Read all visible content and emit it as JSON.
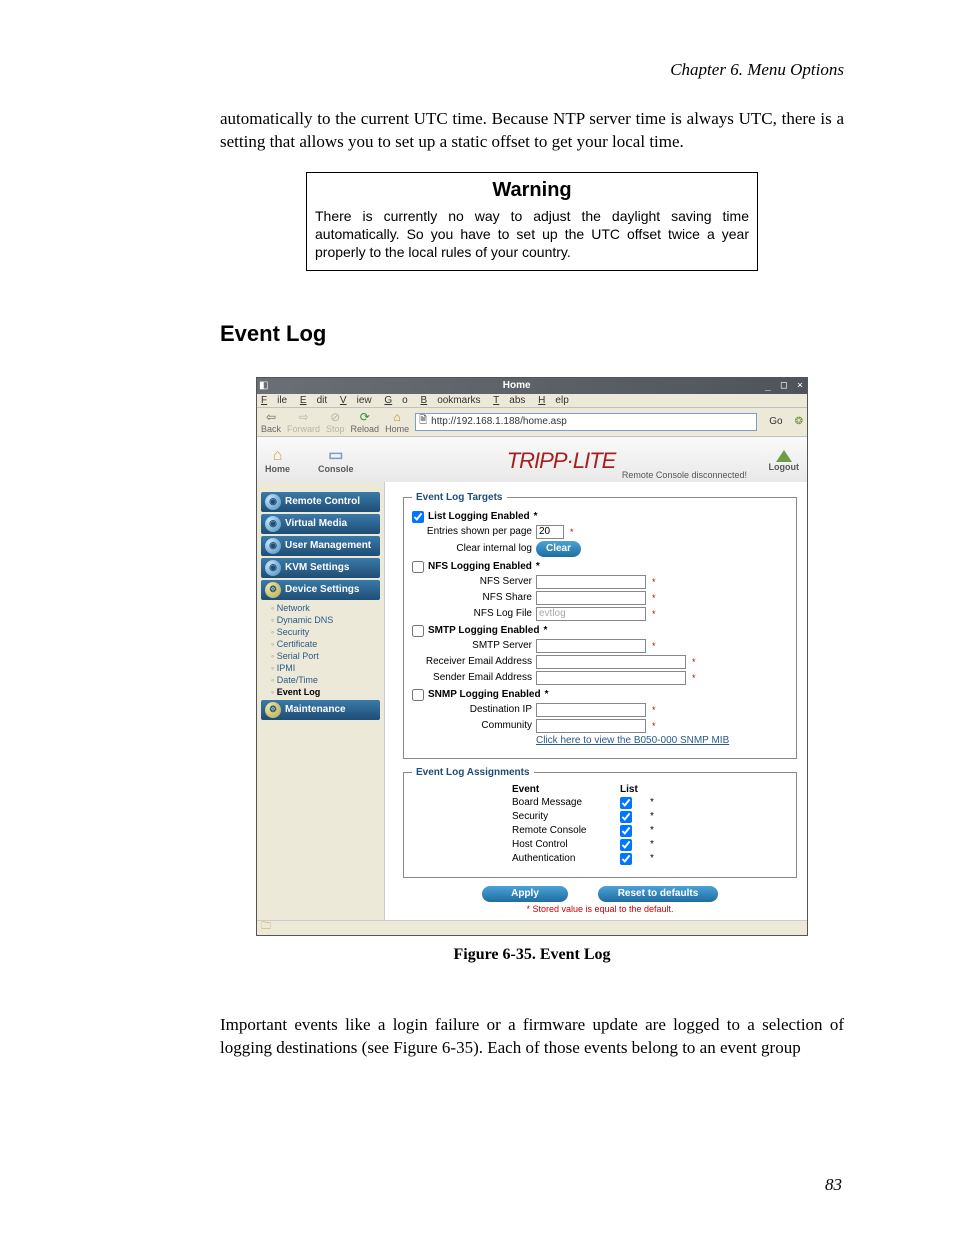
{
  "page": {
    "chapter_header": "Chapter 6. Menu Options",
    "intro_para": "automatically to the current UTC time. Because NTP server time is always UTC, there is a setting that allows you to set up a static offset to get your local time.",
    "warning_title": "Warning",
    "warning_body": "There is currently no way to adjust the daylight saving time automatically. So you have to set up the UTC offset twice a year properly to the local rules of your country.",
    "section_title": "Event Log",
    "figure_caption": "Figure 6-35. Event Log",
    "outro_para": "Important events like a login failure or a firmware update are logged to a selection of logging destinations (see Figure 6-35). Each of those events belong to an event group",
    "page_number": "83"
  },
  "browser": {
    "window_title": "Home",
    "window_controls": "_ □ ×",
    "menus": [
      "File",
      "Edit",
      "View",
      "Go",
      "Bookmarks",
      "Tabs",
      "Help"
    ],
    "toolbar": {
      "back": "Back",
      "forward": "Forward",
      "stop": "Stop",
      "reload": "Reload",
      "home": "Home",
      "go": "Go"
    },
    "url": "http://192.168.1.188/home.asp"
  },
  "appbar": {
    "home": "Home",
    "console": "Console",
    "logo_text": "TRIPP·LITE",
    "status": "Remote Console disconnected!",
    "logout": "Logout"
  },
  "sidebar": {
    "sections": [
      "Remote Control",
      "Virtual Media",
      "User Management",
      "KVM Settings",
      "Device Settings",
      "Maintenance"
    ],
    "device_links": [
      "Network",
      "Dynamic DNS",
      "Security",
      "Certificate",
      "Serial Port",
      "IPMI",
      "Date/Time",
      "Event Log"
    ]
  },
  "main": {
    "fs1": {
      "legend": "Event Log Targets",
      "list_group": "List Logging Enabled",
      "entries_label": "Entries shown per page",
      "entries_value": "20",
      "clear_label": "Clear internal log",
      "clear_btn": "Clear",
      "nfs_group": "NFS Logging Enabled",
      "nfs_server": "NFS Server",
      "nfs_share": "NFS Share",
      "nfs_logfile": "NFS Log File",
      "nfs_logfile_value": "evtlog",
      "smtp_group": "SMTP Logging Enabled",
      "smtp_server": "SMTP Server",
      "recv_email": "Receiver Email Address",
      "sender_email": "Sender Email Address",
      "snmp_group": "SNMP Logging Enabled",
      "dest_ip": "Destination IP",
      "community": "Community",
      "snmp_link": "Click here to view the B050-000 SNMP MIB"
    },
    "fs2": {
      "legend": "Event Log Assignments",
      "col_event": "Event",
      "col_list": "List",
      "rows": [
        "Board Message",
        "Security",
        "Remote Console",
        "Host Control",
        "Authentication"
      ]
    },
    "apply": "Apply",
    "reset": "Reset to defaults",
    "footnote": "* Stored value is equal to the default."
  }
}
